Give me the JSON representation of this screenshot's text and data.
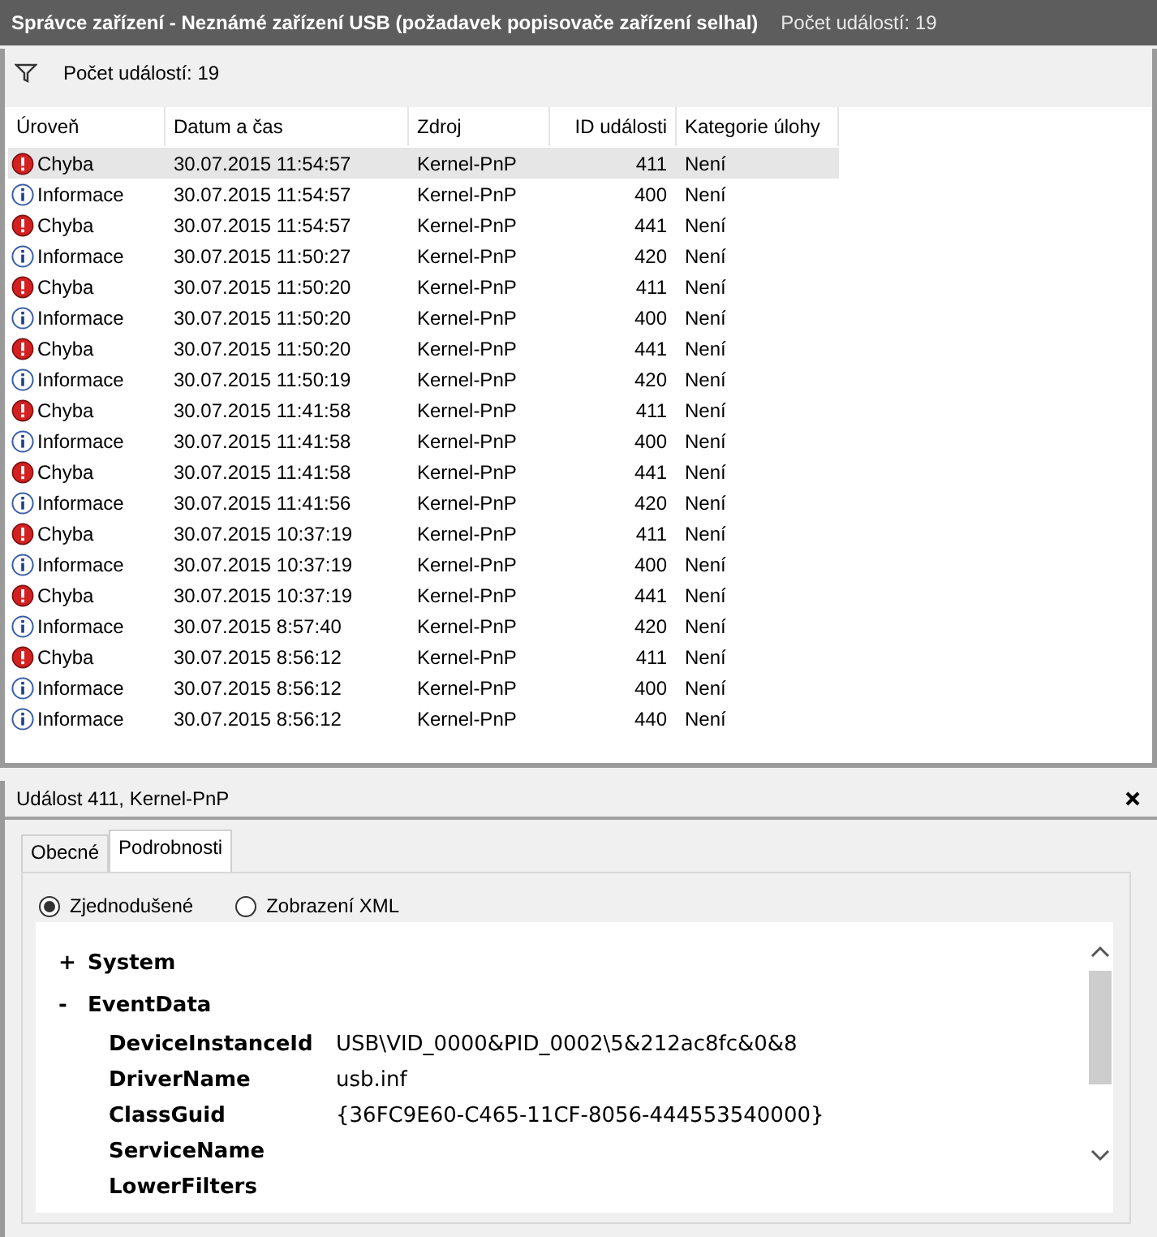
{
  "window": {
    "title": "Správce zařízení - Neznámé zařízení USB (požadavek popisovače zařízení selhal)",
    "event_count": "Počet událostí: 19"
  },
  "toolbar": {
    "label": "Počet událostí: 19"
  },
  "table": {
    "columns": [
      "Úroveň",
      "Datum a čas",
      "Zdroj",
      "ID události",
      "Kategorie úlohy"
    ],
    "rows": [
      {
        "kind": "error",
        "level": "Chyba",
        "date": "30.07.2015 11:54:57",
        "source": "Kernel-PnP",
        "id": "411",
        "category": "Není",
        "selected": true
      },
      {
        "kind": "info",
        "level": "Informace",
        "date": "30.07.2015 11:54:57",
        "source": "Kernel-PnP",
        "id": "400",
        "category": "Není",
        "selected": false
      },
      {
        "kind": "error",
        "level": "Chyba",
        "date": "30.07.2015 11:54:57",
        "source": "Kernel-PnP",
        "id": "441",
        "category": "Není",
        "selected": false
      },
      {
        "kind": "info",
        "level": "Informace",
        "date": "30.07.2015 11:50:27",
        "source": "Kernel-PnP",
        "id": "420",
        "category": "Není",
        "selected": false
      },
      {
        "kind": "error",
        "level": "Chyba",
        "date": "30.07.2015 11:50:20",
        "source": "Kernel-PnP",
        "id": "411",
        "category": "Není",
        "selected": false
      },
      {
        "kind": "info",
        "level": "Informace",
        "date": "30.07.2015 11:50:20",
        "source": "Kernel-PnP",
        "id": "400",
        "category": "Není",
        "selected": false
      },
      {
        "kind": "error",
        "level": "Chyba",
        "date": "30.07.2015 11:50:20",
        "source": "Kernel-PnP",
        "id": "441",
        "category": "Není",
        "selected": false
      },
      {
        "kind": "info",
        "level": "Informace",
        "date": "30.07.2015 11:50:19",
        "source": "Kernel-PnP",
        "id": "420",
        "category": "Není",
        "selected": false
      },
      {
        "kind": "error",
        "level": "Chyba",
        "date": "30.07.2015 11:41:58",
        "source": "Kernel-PnP",
        "id": "411",
        "category": "Není",
        "selected": false
      },
      {
        "kind": "info",
        "level": "Informace",
        "date": "30.07.2015 11:41:58",
        "source": "Kernel-PnP",
        "id": "400",
        "category": "Není",
        "selected": false
      },
      {
        "kind": "error",
        "level": "Chyba",
        "date": "30.07.2015 11:41:58",
        "source": "Kernel-PnP",
        "id": "441",
        "category": "Není",
        "selected": false
      },
      {
        "kind": "info",
        "level": "Informace",
        "date": "30.07.2015 11:41:56",
        "source": "Kernel-PnP",
        "id": "420",
        "category": "Není",
        "selected": false
      },
      {
        "kind": "error",
        "level": "Chyba",
        "date": "30.07.2015 10:37:19",
        "source": "Kernel-PnP",
        "id": "411",
        "category": "Není",
        "selected": false
      },
      {
        "kind": "info",
        "level": "Informace",
        "date": "30.07.2015 10:37:19",
        "source": "Kernel-PnP",
        "id": "400",
        "category": "Není",
        "selected": false
      },
      {
        "kind": "error",
        "level": "Chyba",
        "date": "30.07.2015 10:37:19",
        "source": "Kernel-PnP",
        "id": "441",
        "category": "Není",
        "selected": false
      },
      {
        "kind": "info",
        "level": "Informace",
        "date": "30.07.2015 8:57:40",
        "source": "Kernel-PnP",
        "id": "420",
        "category": "Není",
        "selected": false
      },
      {
        "kind": "error",
        "level": "Chyba",
        "date": "30.07.2015 8:56:12",
        "source": "Kernel-PnP",
        "id": "411",
        "category": "Není",
        "selected": false
      },
      {
        "kind": "info",
        "level": "Informace",
        "date": "30.07.2015 8:56:12",
        "source": "Kernel-PnP",
        "id": "400",
        "category": "Není",
        "selected": false
      },
      {
        "kind": "info",
        "level": "Informace",
        "date": "30.07.2015 8:56:12",
        "source": "Kernel-PnP",
        "id": "440",
        "category": "Není",
        "selected": false
      }
    ]
  },
  "detail": {
    "title": "Událost 411, Kernel-PnP",
    "tabs": [
      {
        "label": "Obecné",
        "selected": false
      },
      {
        "label": "Podrobnosti",
        "selected": true
      }
    ],
    "views": [
      {
        "label": "Zjednodušené",
        "checked": true
      },
      {
        "label": "Zobrazení XML",
        "checked": false
      }
    ],
    "tree": [
      {
        "label": "System",
        "toggle": "+"
      },
      {
        "label": "EventData",
        "toggle": "-",
        "children": [
          {
            "name": "DeviceInstanceId",
            "value": "USB\\VID_0000&PID_0002\\5&212ac8fc&0&8"
          },
          {
            "name": "DriverName",
            "value": "usb.inf"
          },
          {
            "name": "ClassGuid",
            "value": "{36FC9E60-C465-11CF-8056-444553540000}"
          },
          {
            "name": "ServiceName"
          },
          {
            "name": "LowerFilters"
          }
        ]
      }
    ]
  }
}
